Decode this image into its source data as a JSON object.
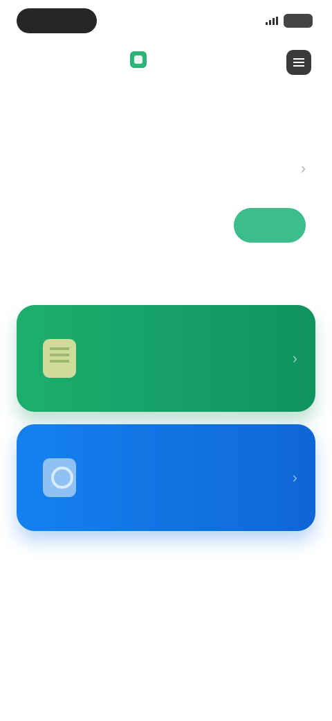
{
  "status_bar": {
    "time": "",
    "icons": [
      "signal-icon",
      "battery-icon"
    ]
  },
  "header": {
    "logo_text": "",
    "logo_icon": "app-logo",
    "menu_icon": "menu-icon"
  },
  "wallet_section": {
    "title": "",
    "link": "",
    "balance_label": "",
    "balance_value": "",
    "plan_label": "",
    "upgrade_button": ""
  },
  "tools_section": {
    "title": "",
    "cards": [
      {
        "title": "",
        "subtitle": "",
        "color": "#1dae6e",
        "icon": "document-icon"
      },
      {
        "title": "",
        "subtitle": "",
        "color": "#1481ef",
        "icon": "scan-icon"
      }
    ]
  },
  "colors": {
    "accent": "#3dbd8b",
    "primary_blue": "#1481ef",
    "primary_green": "#10935f"
  }
}
